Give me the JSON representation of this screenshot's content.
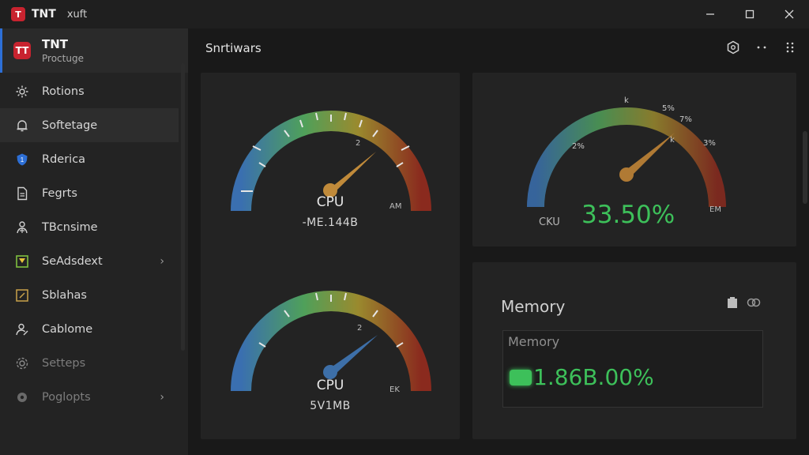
{
  "titlebar": {
    "logo": "T",
    "app_name": "TNT",
    "subtitle": "xuft",
    "controls": [
      "minimize-icon",
      "maximize-icon",
      "close-icon"
    ]
  },
  "sidebar": {
    "logo": "TT",
    "brand": "TNT",
    "brand_sub": "Proctuge",
    "items": [
      {
        "label": "Rotions",
        "icon": "gear-icon"
      },
      {
        "label": "Softetage",
        "icon": "bell-icon"
      },
      {
        "label": "Rderica",
        "icon": "shield-icon"
      },
      {
        "label": "Fegrts",
        "icon": "document-icon"
      },
      {
        "label": "TBcnsime",
        "icon": "user-network-icon"
      },
      {
        "label": "SeAdsdext",
        "icon": "download-box-icon"
      },
      {
        "label": "Sblahas",
        "icon": "edit-box-icon"
      },
      {
        "label": "Cablome",
        "icon": "user-edit-icon"
      },
      {
        "label": "Setteps",
        "icon": "settings-icon"
      },
      {
        "label": "Poglopts",
        "icon": "gear-filled-icon"
      }
    ]
  },
  "main": {
    "title": "Snrtiwars",
    "tools": [
      "hexagon-settings-icon",
      "more-dots-icon",
      "grid-dots-icon"
    ]
  },
  "gauges": {
    "top_left": {
      "label": "CPU",
      "value": "-ME.144B",
      "end_label": "AM",
      "tick_text": "2"
    },
    "bottom_left": {
      "label": "CPU",
      "value": "5V1MB",
      "end_label": "EK",
      "tick_text": "2"
    },
    "right": {
      "label": "CKU",
      "percent": "33.50%",
      "end_label": "EM",
      "tick_labels": [
        "2%",
        "k",
        "5%",
        "7%",
        "3%",
        "k"
      ]
    }
  },
  "memory": {
    "title": "Memory",
    "sub_label": "Memory",
    "value": "1.86B.00%"
  },
  "colors": {
    "accent": "#2d6fd6",
    "brand": "#c8232f",
    "good": "#3dc05a"
  }
}
